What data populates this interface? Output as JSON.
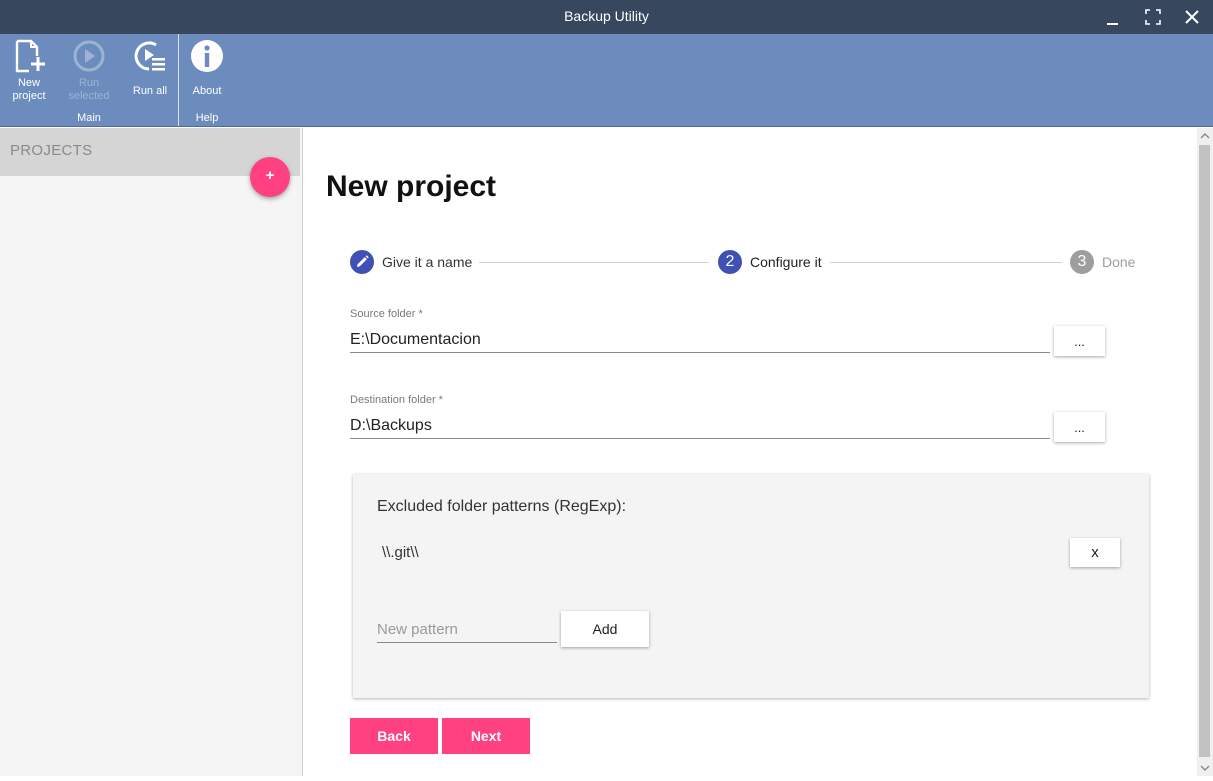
{
  "window": {
    "title": "Backup Utility"
  },
  "ribbon": {
    "new_project": {
      "line1": "New",
      "line2": "project",
      "icon": "new-project-icon"
    },
    "run_selected": {
      "line1": "Run",
      "line2": "selected",
      "icon": "run-icon",
      "disabled": true
    },
    "run_all": {
      "label": "Run all",
      "icon": "run-all-icon"
    },
    "main_group": "Main",
    "about": {
      "label": "About",
      "icon": "info-icon"
    },
    "help_group": "Help"
  },
  "sidebar": {
    "heading": "PROJECTS",
    "add_button": "+"
  },
  "main": {
    "title": "New project",
    "steps": [
      {
        "label": "Give it a name",
        "marker": "edit-icon",
        "state": "completed"
      },
      {
        "label": "Configure it",
        "marker": "2",
        "state": "active"
      },
      {
        "label": "Done",
        "marker": "3",
        "state": "pending"
      }
    ],
    "source": {
      "label": "Source folder *",
      "value": "E:\\Documentacion",
      "browse": "..."
    },
    "destination": {
      "label": "Destination folder *",
      "value": "D:\\Backups",
      "browse": "..."
    },
    "exclusions": {
      "title": "Excluded folder patterns (RegExp):",
      "patterns": [
        "\\\\.git\\\\"
      ],
      "remove_label": "x",
      "new_placeholder": "New pattern",
      "add_label": "Add"
    },
    "back_label": "Back",
    "next_label": "Next"
  },
  "colors": {
    "titlebar": "#36475e",
    "ribbon": "#6b8cbd",
    "accent_pink": "#ff4081",
    "step_active": "#3f51b5",
    "step_pending": "#9e9e9e"
  }
}
